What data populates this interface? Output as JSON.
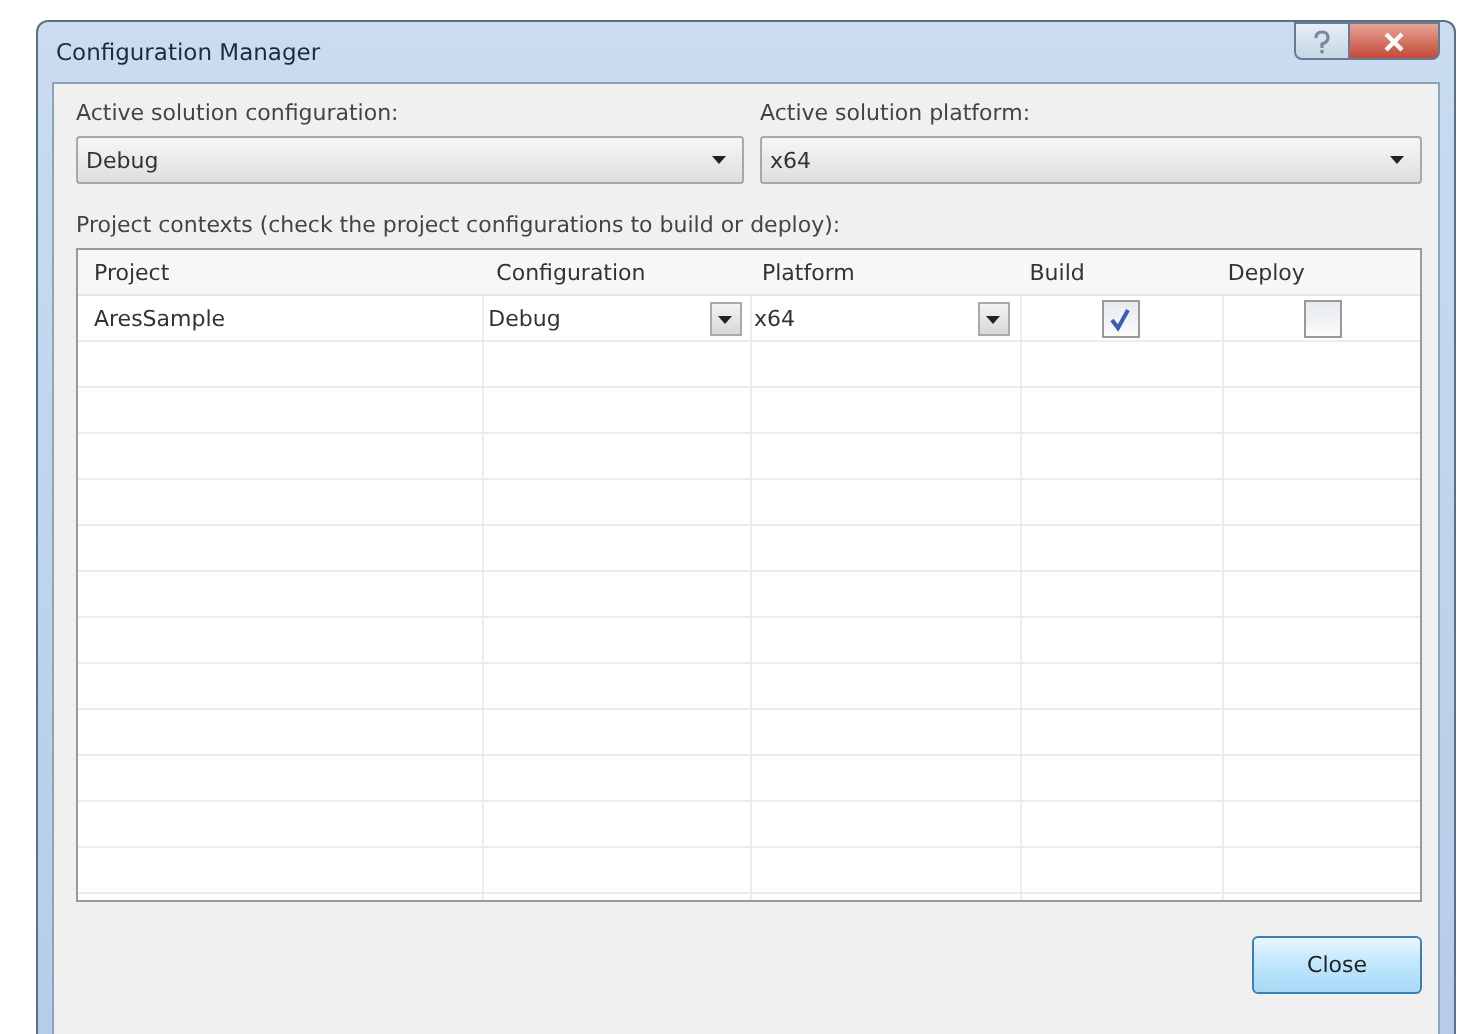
{
  "window": {
    "title": "Configuration Manager"
  },
  "active_configuration": {
    "label": "Active solution configuration:",
    "value": "Debug"
  },
  "active_platform": {
    "label": "Active solution platform:",
    "value": "x64"
  },
  "contexts_label": "Project contexts (check the project configurations to build or deploy):",
  "table": {
    "columns": [
      "Project",
      "Configuration",
      "Platform",
      "Build",
      "Deploy"
    ],
    "rows": [
      {
        "project": "AresSample",
        "configuration": "Debug",
        "platform": "x64",
        "build": true,
        "deploy": false
      }
    ]
  },
  "buttons": [
    "Close"
  ]
}
